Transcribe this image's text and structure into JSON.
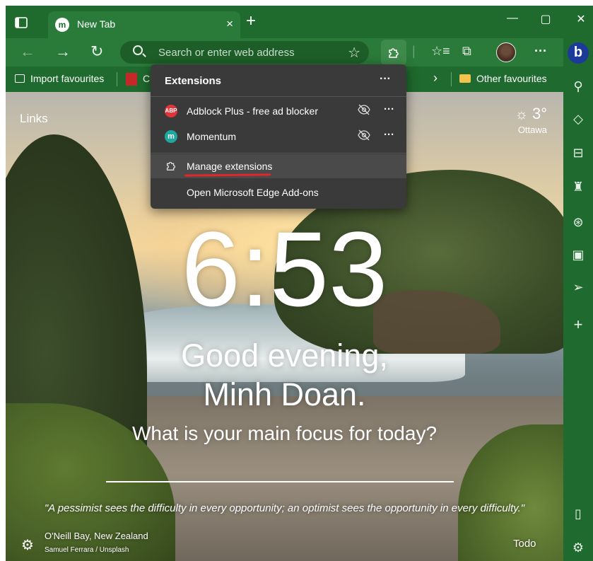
{
  "browser": {
    "tab": {
      "title": "New Tab",
      "favicon_letter": "m",
      "close": "×"
    },
    "new_tab": "+",
    "window": {
      "minimize": "—",
      "maximize": "▢",
      "close": "✕"
    }
  },
  "navbar": {
    "back": "←",
    "forward": "→",
    "refresh": "↻",
    "address_placeholder": "Search or enter web address",
    "more": "···"
  },
  "favourites_bar": {
    "import": "Import favourites",
    "truncated_item": "C",
    "chevron": "›",
    "other": "Other favourites"
  },
  "extensions_popup": {
    "title": "Extensions",
    "more": "···",
    "items": [
      {
        "name": "Adblock Plus - free ad blocker",
        "logo_text": "ABP",
        "logo_color": "#e0353a"
      },
      {
        "name": "Momentum",
        "logo_text": "m",
        "logo_color": "#20a7a0"
      }
    ],
    "manage": "Manage extensions",
    "addons": "Open Microsoft Edge Add-ons"
  },
  "new_tab_page": {
    "links": "Links",
    "weather": {
      "temp": "3°",
      "city": "Ottawa"
    },
    "time": "6:53",
    "greeting_line1": "Good evening,",
    "greeting_line2": "Minh Doan.",
    "focus_question": "What is your main focus for today?",
    "quote": "\"A pessimist sees the difficulty in every opportunity; an optimist sees the opportunity in every difficulty.\"",
    "photo_location": "O'Neill Bay, New Zealand",
    "photo_credit": "Samuel Ferrara / Unsplash",
    "todo": "Todo"
  },
  "colors": {
    "theme_green": "#1f6a2e",
    "popup_bg": "#3a3a3a",
    "highlight_underline": "#e3262b"
  },
  "icons": {
    "tab_actions": "tab-actions-icon",
    "extensions": "puzzle-icon",
    "favorites": "favorites-icon",
    "collections": "collections-icon",
    "bing": "bing-icon",
    "hide": "eye-slash-icon",
    "weather": "sun-icon"
  }
}
